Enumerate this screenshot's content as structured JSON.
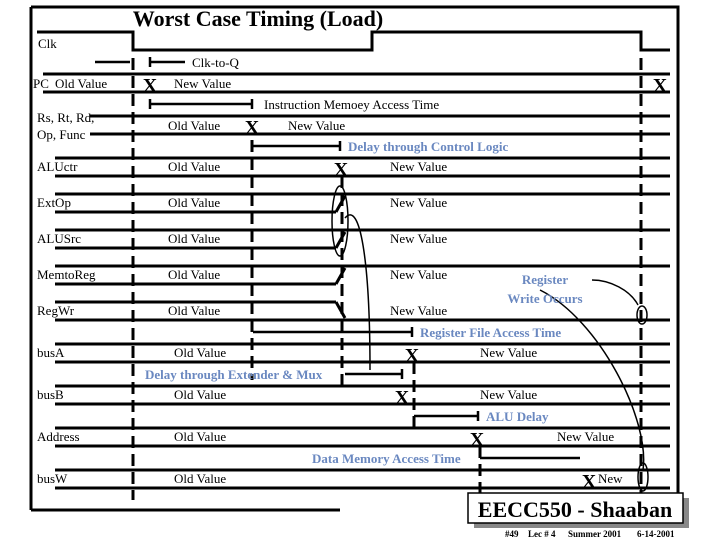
{
  "title": "Worst Case Timing (Load)",
  "signals": [
    {
      "name": "Clk"
    },
    {
      "name": "PC",
      "old": "Old Value",
      "new": "New Value"
    },
    {
      "name": "Rs, Rt, Rd,",
      "name2": "Op, Func",
      "old": "Old Value",
      "new": "New Value"
    },
    {
      "name": "ALUctr",
      "old": "Old Value",
      "new": "New Value"
    },
    {
      "name": "ExtOp",
      "old": "Old Value",
      "new": "New Value"
    },
    {
      "name": "ALUSrc",
      "old": "Old Value",
      "new": "New Value"
    },
    {
      "name": "MemtoReg",
      "old": "Old Value",
      "new": "New Value"
    },
    {
      "name": "RegWr",
      "old": "Old Value",
      "new": "New Value"
    },
    {
      "name": "busA",
      "old": "Old Value",
      "new": "New Value"
    },
    {
      "name": "busB",
      "old": "Old Value",
      "new": "New Value"
    },
    {
      "name": "Address",
      "old": "Old Value",
      "new": "New Value"
    },
    {
      "name": "busW",
      "old": "Old Value",
      "new": "New"
    }
  ],
  "annotations": {
    "clk_to_q": "Clk-to-Q",
    "imem": "Instruction Memoey Access Time",
    "control": "Delay through Control Logic",
    "reg_write_1": "Register",
    "reg_write_2": "Write Occurs",
    "regfile": "Register File Access Time",
    "extender": "Delay through Extender & Mux",
    "alu": "ALU Delay",
    "dmem": "Data Memory Access Time"
  },
  "footer": {
    "brand": "EECC550 - Shaaban",
    "slide": "#49",
    "lecture": "Lec # 4",
    "term": "Summer 2001",
    "date": "6-14-2001"
  },
  "colors": {
    "annotation": "#6a88c0"
  }
}
